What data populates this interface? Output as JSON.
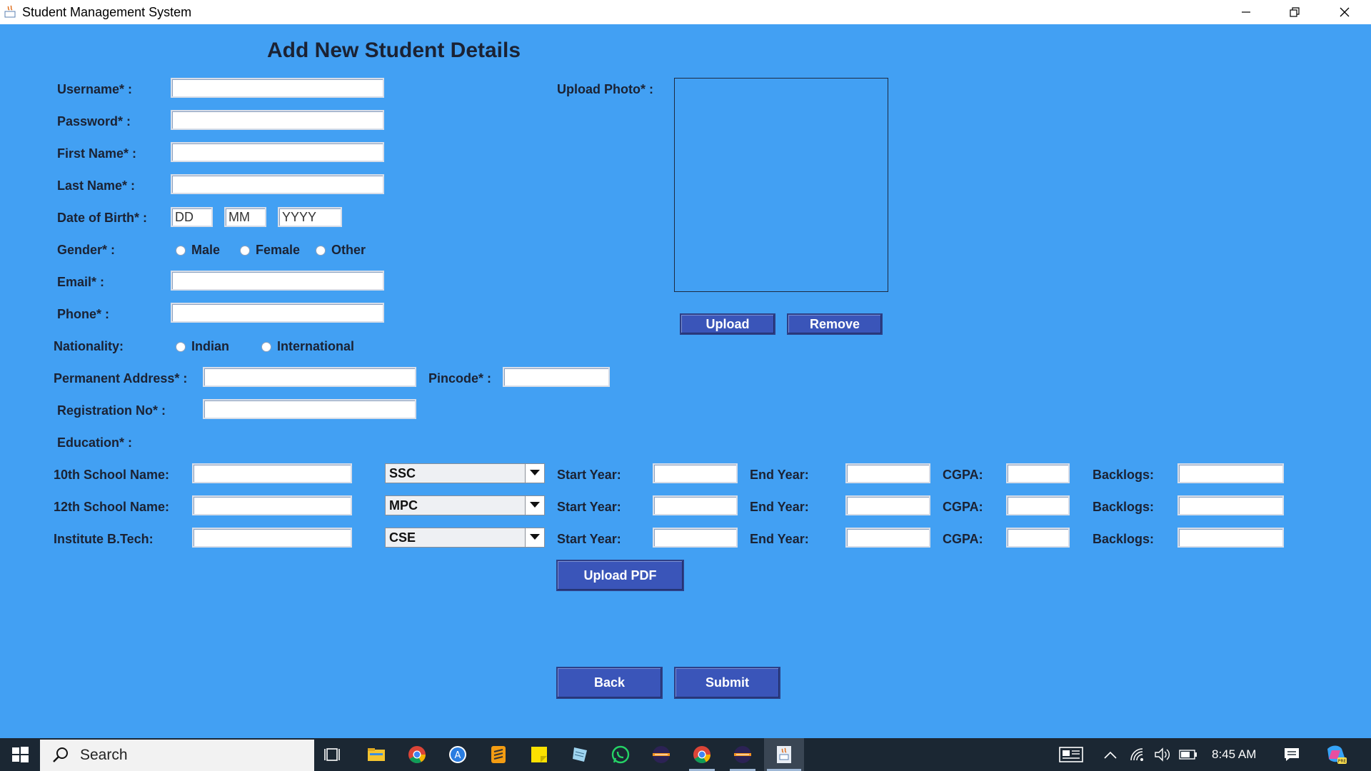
{
  "window": {
    "title": "Student Management System",
    "controls": [
      "minimize-icon",
      "restore-icon",
      "close-icon"
    ]
  },
  "form": {
    "heading": "Add New Student Details",
    "labels": {
      "username": "Username* :",
      "password": "Password* :",
      "first_name": "First Name* :",
      "last_name": "Last Name* :",
      "dob": "Date of Birth* :",
      "gender": "Gender* :",
      "email": "Email* :",
      "phone": "Phone* :",
      "nationality": "Nationality:",
      "address": "Permanent Address* :",
      "pincode": "Pincode* :",
      "registration": "Registration No* :",
      "education": "Education* :",
      "upload_photo": "Upload Photo* :"
    },
    "dob_placeholders": {
      "day": "DD",
      "month": "MM",
      "year": "YYYY"
    },
    "gender_options": [
      "Male",
      "Female",
      "Other"
    ],
    "nationality_options": [
      "Indian",
      "International"
    ],
    "photo_buttons": {
      "upload": "Upload",
      "remove": "Remove"
    },
    "education_rows": [
      {
        "label": "10th School Name:",
        "combo": "SSC",
        "start_label": "Start Year:",
        "end_label": "End Year:",
        "cgpa_label": "CGPA:",
        "backlogs_label": "Backlogs:"
      },
      {
        "label": "12th School Name:",
        "combo": "MPC",
        "start_label": "Start Year:",
        "end_label": "End Year:",
        "cgpa_label": "CGPA:",
        "backlogs_label": "Backlogs:"
      },
      {
        "label": "Institute B.Tech:",
        "combo": "CSE",
        "start_label": "Start Year:",
        "end_label": "End Year:",
        "cgpa_label": "CGPA:",
        "backlogs_label": "Backlogs:"
      }
    ],
    "upload_pdf": "Upload PDF",
    "back": "Back",
    "submit": "Submit"
  },
  "taskbar": {
    "search_placeholder": "Search",
    "apps": [
      "task-view-icon",
      "file-explorer-icon",
      "chrome-icon",
      "app-store-icon",
      "sublime-text-icon",
      "sticky-notes-icon",
      "notepad-icon",
      "whatsapp-icon",
      "eclipse-icon",
      "chrome-profile-icon",
      "eclipse-2-icon",
      "java-app-icon"
    ],
    "time": "8:45 AM"
  },
  "colors": {
    "background": "#42a0f3",
    "button": "#3a55b9",
    "taskbar": "#1b2733"
  }
}
